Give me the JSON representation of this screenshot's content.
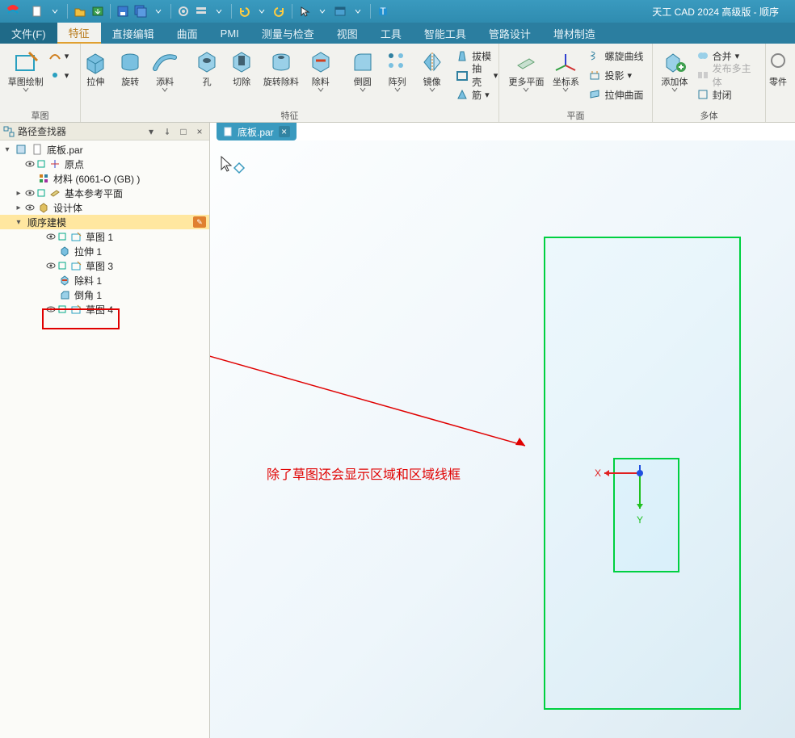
{
  "app": {
    "title": "天工 CAD 2024 高级版 - 顺序"
  },
  "menu": {
    "file": "文件(F)",
    "items": [
      "特征",
      "直接编辑",
      "曲面",
      "PMI",
      "测量与检查",
      "视图",
      "工具",
      "智能工具",
      "管路设计",
      "增材制造"
    ],
    "activeIndex": 0
  },
  "ribbon": {
    "groups": {
      "sketch": {
        "label": "草图",
        "draw": "草图绘制"
      },
      "feature": {
        "label": "特征",
        "extrude": "拉伸",
        "revolve": "旋转",
        "sweep": "添料",
        "hole": "孔",
        "cut": "切除",
        "rotcut": "旋转除料",
        "remove": "除料",
        "fillet": "倒圆",
        "array": "阵列",
        "mirror": "镜像",
        "draft": "拔模",
        "shell": "抽壳",
        "rib": "筋"
      },
      "plane": {
        "label": "平面",
        "more": "更多平面",
        "coord": "坐标系",
        "helix": "螺旋曲线",
        "project": "投影",
        "extcurve": "拉伸曲面"
      },
      "body": {
        "label": "多体",
        "add": "添加体",
        "union": "合并",
        "publish": "发布多主体",
        "close": "封闭"
      },
      "part": {
        "label": "",
        "part": "零件"
      }
    }
  },
  "pathfinder": {
    "title": "路径查找器",
    "root": "底板.par",
    "origin": "原点",
    "material": "材料 (6061-O (GB) )",
    "refplane": "基本参考平面",
    "designbody": "设计体",
    "seqmodel": "顺序建模",
    "items": {
      "sk1": "草图 1",
      "ext1": "拉伸 1",
      "sk3": "草图 3",
      "rm1": "除料 1",
      "ch1": "倒角 1",
      "sk4": "草图 4"
    }
  },
  "doctab": {
    "name": "底板.par"
  },
  "annotation": {
    "text": "除了草图还会显示区域和区域线框"
  },
  "axes": {
    "x": "X",
    "y": "Y"
  }
}
